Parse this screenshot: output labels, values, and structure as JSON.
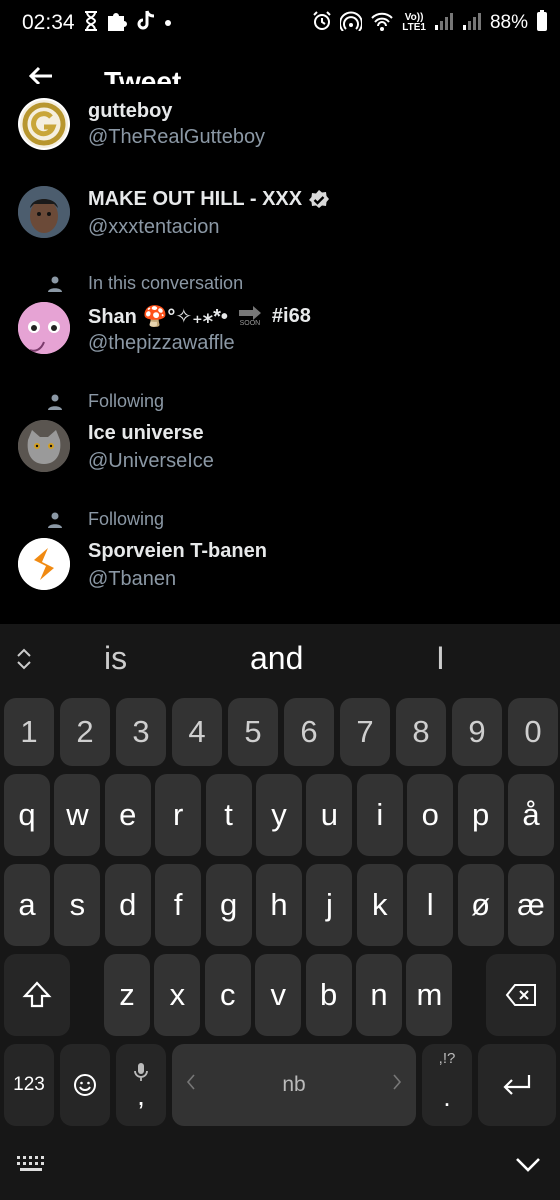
{
  "status_bar": {
    "time": "02:34",
    "battery": "88%",
    "network_top": "Vo))",
    "network_bottom": "LTE1"
  },
  "header": {
    "title": "Tweet"
  },
  "suggestions": [
    {
      "name": "gutteboy",
      "handle": "@TheRealGutteboy",
      "context": "",
      "verified": false,
      "avatar": "gold-g-logo"
    },
    {
      "name": "MAKE OUT HILL - XXX",
      "handle": "@xxxtentacion",
      "context": "",
      "verified": true,
      "avatar": "person-photo"
    },
    {
      "name": "Shan 🍄°✧₊⁎*•",
      "name_tag": "#i68",
      "soon_label": "SOON",
      "handle": "@thepizzawaffle",
      "context": "In this conversation",
      "verified": false,
      "avatar": "pink-cartoon"
    },
    {
      "name": "Ice universe",
      "handle": "@UniverseIce",
      "context": "Following",
      "verified": false,
      "avatar": "cat-photo"
    },
    {
      "name": "Sporveien T-banen",
      "handle": "@Tbanen",
      "context": "Following",
      "verified": false,
      "avatar": "orange-s-logo"
    }
  ],
  "keyboard": {
    "predictions": [
      "is",
      "and",
      "I"
    ],
    "number_row": [
      "1",
      "2",
      "3",
      "4",
      "5",
      "6",
      "7",
      "8",
      "9",
      "0"
    ],
    "row1": [
      "q",
      "w",
      "e",
      "r",
      "t",
      "y",
      "u",
      "i",
      "o",
      "p",
      "å"
    ],
    "row2": [
      "a",
      "s",
      "d",
      "f",
      "g",
      "h",
      "j",
      "k",
      "l",
      "ø",
      "æ"
    ],
    "row3": [
      "z",
      "x",
      "c",
      "v",
      "b",
      "n",
      "m"
    ],
    "symbols_label": "123",
    "comma": ",",
    "space_label": "nb",
    "period": ".",
    "punct_hint": ",!?"
  },
  "colors": {
    "background": "#000000",
    "secondary_text": "#8b98a5",
    "keyboard_bg": "#171717",
    "key_bg": "#333333"
  }
}
